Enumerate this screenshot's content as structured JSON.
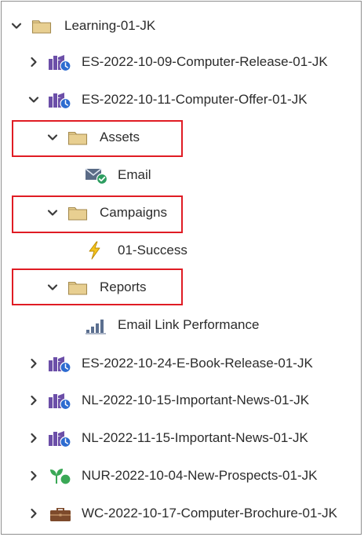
{
  "tree": {
    "root": {
      "label": "Learning-01-JK",
      "icon": "folder-icon",
      "expanded": true
    },
    "programs": [
      {
        "label": "ES-2022-10-09-Computer-Release-01-JK",
        "icon": "email-program-icon",
        "expanded": false
      },
      {
        "label": "ES-2022-10-11-Computer-Offer-01-JK",
        "icon": "email-program-icon",
        "expanded": true,
        "children": [
          {
            "label": "Assets",
            "icon": "folder-icon",
            "expanded": true,
            "highlighted": true,
            "children": [
              {
                "label": "Email",
                "icon": "email-approved-icon"
              }
            ]
          },
          {
            "label": "Campaigns",
            "icon": "folder-icon",
            "expanded": true,
            "highlighted": true,
            "children": [
              {
                "label": "01-Success",
                "icon": "trigger-campaign-icon"
              }
            ]
          },
          {
            "label": "Reports",
            "icon": "folder-icon",
            "expanded": true,
            "highlighted": true,
            "children": [
              {
                "label": "Email Link Performance",
                "icon": "report-chart-icon"
              }
            ]
          }
        ]
      },
      {
        "label": "ES-2022-10-24-E-Book-Release-01-JK",
        "icon": "email-program-icon",
        "expanded": false
      },
      {
        "label": "NL-2022-10-15-Important-News-01-JK",
        "icon": "email-program-icon",
        "expanded": false
      },
      {
        "label": "NL-2022-11-15-Important-News-01-JK",
        "icon": "email-program-icon",
        "expanded": false
      },
      {
        "label": "NUR-2022-10-04-New-Prospects-01-JK",
        "icon": "nurture-program-icon",
        "expanded": false
      },
      {
        "label": "WC-2022-10-17-Computer-Brochure-01-JK",
        "icon": "event-program-icon",
        "expanded": false
      }
    ]
  },
  "colors": {
    "highlight": "#e01c24",
    "folder_fill": "#e8cf91",
    "folder_stroke": "#a48a4e",
    "program_purple": "#6c4fa8",
    "clock_blue": "#2d6bd0",
    "approved_green": "#2d9d60",
    "bolt_yellow": "#f4c21c",
    "nurture_green": "#3aa856",
    "briefcase_brown": "#7d4a2b"
  }
}
